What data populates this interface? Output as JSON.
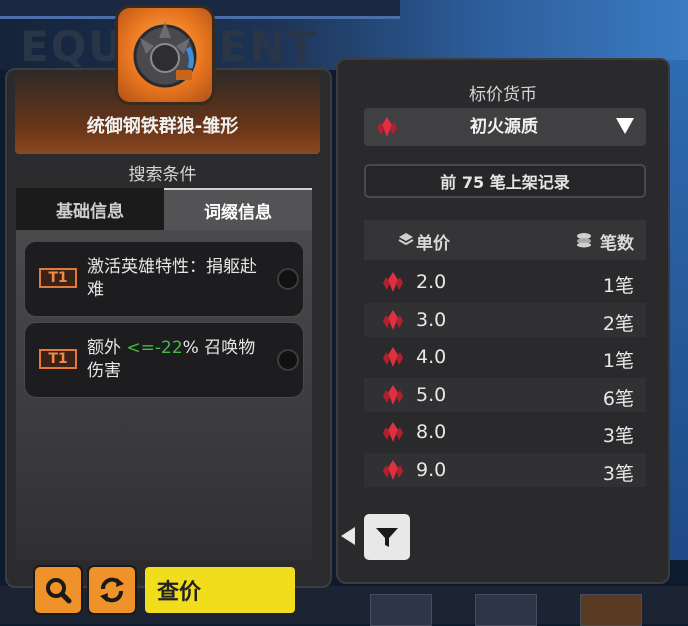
{
  "colors": {
    "accent_orange": "#f0922a",
    "query_yellow": "#f2dd1c",
    "range_green": "#3fbf3f",
    "tier_orange": "#e07a3a"
  },
  "background": {
    "title": "EQUIPMENT"
  },
  "item": {
    "name": "统御钢铁群狼-雏形",
    "icon": "steel-wolf-emblem-icon"
  },
  "search": {
    "title": "搜索条件",
    "tabs": [
      {
        "label": "基础信息",
        "active": false
      },
      {
        "label": "词缀信息",
        "active": true
      }
    ],
    "affixes": [
      {
        "tier": "T1",
        "text": "激活英雄特性：捐躯赴难"
      },
      {
        "tier": "T1",
        "prefix": "额外 ",
        "range": "<=-22",
        "suffix": "% 召唤物伤害"
      }
    ]
  },
  "buttons": {
    "query": "查价",
    "search_icon": "magnifier-icon",
    "refresh_icon": "refresh-icon"
  },
  "market": {
    "currency_label": "标价货币",
    "currency": "初火源质",
    "records": "前 75 笔上架记录",
    "header": {
      "price": "单价",
      "count": "笔数"
    },
    "rows": [
      {
        "price": "2.0",
        "count": "1笔"
      },
      {
        "price": "3.0",
        "count": "2笔"
      },
      {
        "price": "4.0",
        "count": "1笔"
      },
      {
        "price": "5.0",
        "count": "6笔"
      },
      {
        "price": "8.0",
        "count": "3笔"
      },
      {
        "price": "9.0",
        "count": "3笔"
      }
    ],
    "filter_icon": "funnel-icon"
  }
}
